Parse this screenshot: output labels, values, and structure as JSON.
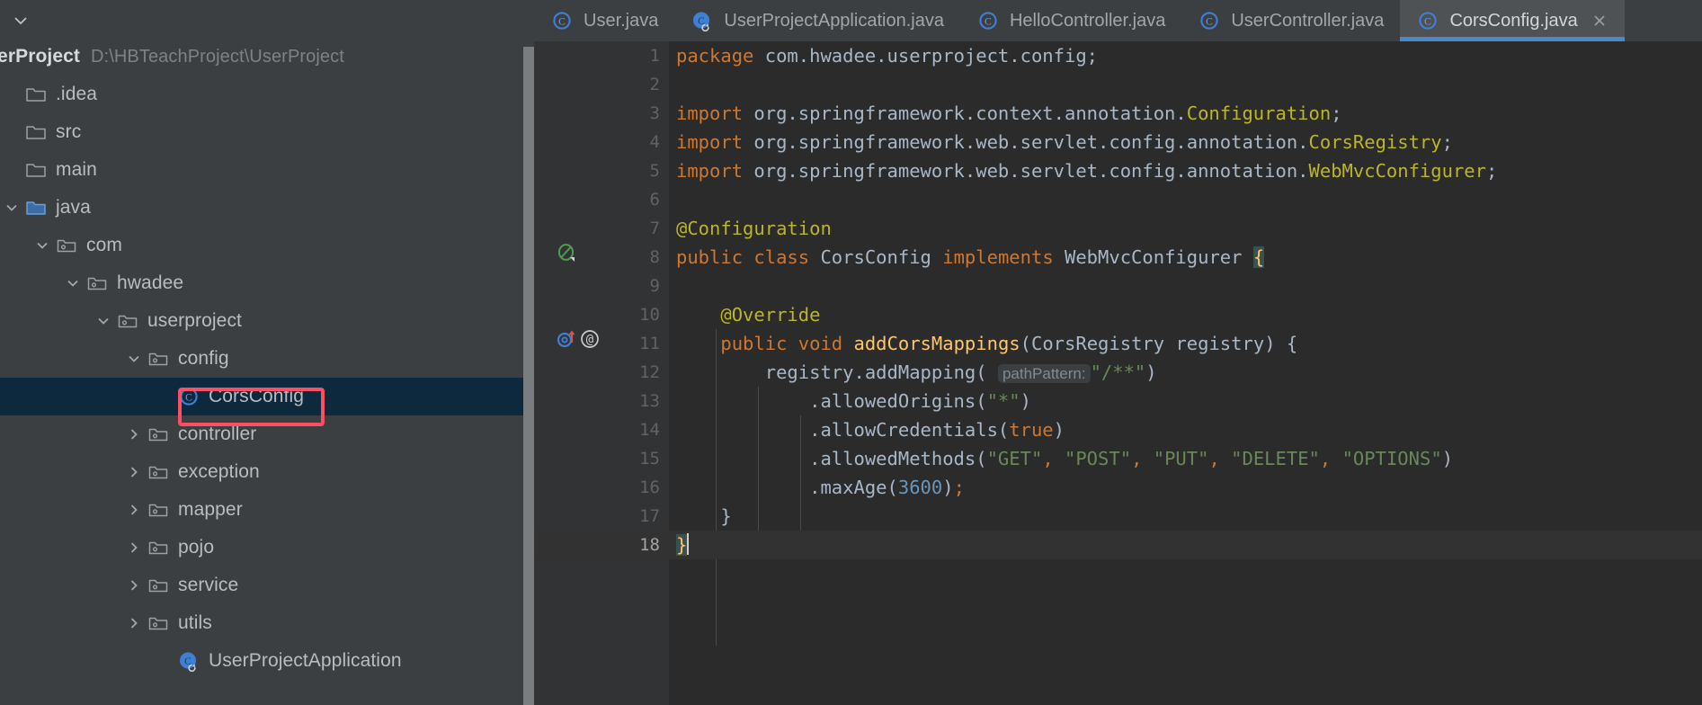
{
  "sidebar": {
    "collapse_icon": "chevron-down-icon",
    "project": {
      "name": "UserProject",
      "path": "D:\\HBTeachProject\\UserProject"
    },
    "tree": [
      {
        "label": ".idea",
        "icon": "folder-icon",
        "arrow": "none",
        "indent": 0,
        "selected": false
      },
      {
        "label": "src",
        "icon": "folder-icon",
        "arrow": "none",
        "indent": 0,
        "selected": false
      },
      {
        "label": "main",
        "icon": "folder-icon",
        "arrow": "none",
        "indent": 1,
        "selected": false
      },
      {
        "label": "java",
        "icon": "source-folder-icon",
        "arrow": "expanded",
        "indent": 1,
        "selected": false
      },
      {
        "label": "com",
        "icon": "package-icon",
        "arrow": "expanded",
        "indent": 2,
        "selected": false
      },
      {
        "label": "hwadee",
        "icon": "package-icon",
        "arrow": "expanded",
        "indent": 3,
        "selected": false
      },
      {
        "label": "userproject",
        "icon": "package-icon",
        "arrow": "expanded",
        "indent": 4,
        "selected": false
      },
      {
        "label": "config",
        "icon": "package-icon",
        "arrow": "expanded",
        "indent": 5,
        "selected": false
      },
      {
        "label": "CorsConfig",
        "icon": "java-class-icon",
        "arrow": "none",
        "indent": 6,
        "selected": true
      },
      {
        "label": "controller",
        "icon": "package-icon",
        "arrow": "collapsed",
        "indent": 5,
        "selected": false
      },
      {
        "label": "exception",
        "icon": "package-icon",
        "arrow": "collapsed",
        "indent": 5,
        "selected": false
      },
      {
        "label": "mapper",
        "icon": "package-icon",
        "arrow": "collapsed",
        "indent": 5,
        "selected": false
      },
      {
        "label": "pojo",
        "icon": "package-icon",
        "arrow": "collapsed",
        "indent": 5,
        "selected": false
      },
      {
        "label": "service",
        "icon": "package-icon",
        "arrow": "collapsed",
        "indent": 5,
        "selected": false
      },
      {
        "label": "utils",
        "icon": "package-icon",
        "arrow": "collapsed",
        "indent": 5,
        "selected": false
      },
      {
        "label": "UserProjectApplication",
        "icon": "spring-boot-class-icon",
        "arrow": "none",
        "indent": 6,
        "selected": false
      }
    ],
    "annotation": {
      "color": "#ff4d62",
      "target": "CorsConfig"
    }
  },
  "editor": {
    "tabs": [
      {
        "label": "User.java",
        "icon": "java-class-icon",
        "active": false,
        "closable": false
      },
      {
        "label": "UserProjectApplication.java",
        "icon": "spring-boot-class-icon",
        "active": false,
        "closable": false
      },
      {
        "label": "HelloController.java",
        "icon": "java-class-icon",
        "active": false,
        "closable": false
      },
      {
        "label": "UserController.java",
        "icon": "java-class-icon",
        "active": false,
        "closable": false
      },
      {
        "label": "CorsConfig.java",
        "icon": "java-class-icon",
        "active": true,
        "closable": true
      }
    ],
    "active_tab_accent": "#4a88c7",
    "caret_line": 18,
    "lines": [
      {
        "n": 1,
        "gutter": []
      },
      {
        "n": 2,
        "gutter": []
      },
      {
        "n": 3,
        "gutter": []
      },
      {
        "n": 4,
        "gutter": []
      },
      {
        "n": 5,
        "gutter": []
      },
      {
        "n": 6,
        "gutter": []
      },
      {
        "n": 7,
        "gutter": []
      },
      {
        "n": 8,
        "gutter": [
          "spring-bean-icon"
        ]
      },
      {
        "n": 9,
        "gutter": []
      },
      {
        "n": 10,
        "gutter": []
      },
      {
        "n": 11,
        "gutter": [
          "overriding-method-icon",
          "annotation-at-icon"
        ]
      },
      {
        "n": 12,
        "gutter": []
      },
      {
        "n": 13,
        "gutter": []
      },
      {
        "n": 14,
        "gutter": []
      },
      {
        "n": 15,
        "gutter": []
      },
      {
        "n": 16,
        "gutter": []
      },
      {
        "n": 17,
        "gutter": []
      },
      {
        "n": 18,
        "gutter": []
      }
    ],
    "code": {
      "l1_package_kw": "package",
      "l1_name": " com.hwadee.userproject.config;",
      "l3_import_kw": "import",
      "l3_pkg": " org.springframework.context.annotation.",
      "l3_cls": "Configuration",
      "l3_semi": ";",
      "l4_import_kw": "import",
      "l4_pkg": " org.springframework.web.servlet.config.annotation.",
      "l4_cls": "CorsRegistry",
      "l4_semi": ";",
      "l5_import_kw": "import",
      "l5_pkg": " org.springframework.web.servlet.config.annotation.",
      "l5_cls": "WebMvcConfigurer",
      "l5_semi": ";",
      "l7_annotation": "@Configuration",
      "l8_public": "public",
      "l8_class": "class",
      "l8_name": "CorsConfig",
      "l8_implements": "implements",
      "l8_iface": "WebMvcConfigurer",
      "l8_brace": "{",
      "l10_annotation": "@Override",
      "l11_public": "public",
      "l11_void": "void",
      "l11_method": "addCorsMappings",
      "l11_param_type": "CorsRegistry",
      "l11_param_name": "registry",
      "l12_call": "registry.addMapping(",
      "l12_inlay": "pathPattern:",
      "l12_arg": "\"/**\"",
      "l13_call": ".allowedOrigins(",
      "l13_arg": "\"*\"",
      "l14_call": ".allowCredentials(",
      "l14_arg": "true",
      "l15_call": ".allowedMethods(",
      "l15_args": [
        "\"GET\"",
        "\"POST\"",
        "\"PUT\"",
        "\"DELETE\"",
        "\"OPTIONS\""
      ],
      "l16_call": ".maxAge(",
      "l16_arg": "3600",
      "l17_brace": "}",
      "l18_brace": "}"
    }
  },
  "theme": {
    "bg_editor": "#2b2b2b",
    "bg_panel": "#3c3f41",
    "gutter": "#313335",
    "keyword": "#cc7832",
    "string": "#6a8759",
    "number": "#6897bb",
    "annotation_color": "#bbb529",
    "method": "#ffc66d",
    "identifier": "#a9b7c6",
    "selection": "#0d293e",
    "accent": "#4a88c7"
  }
}
